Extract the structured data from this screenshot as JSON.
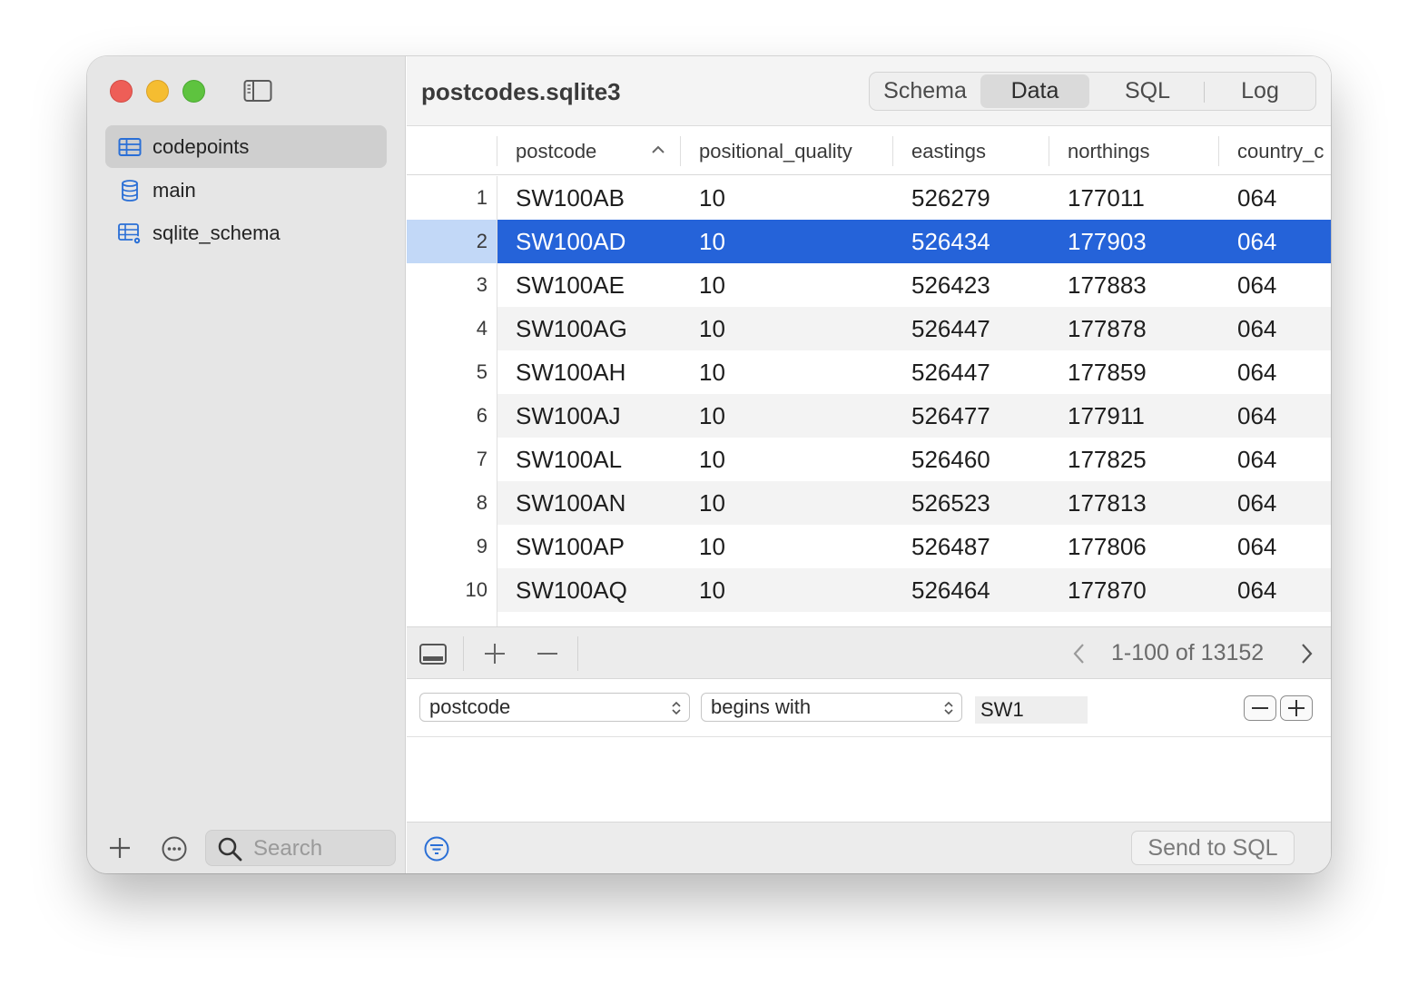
{
  "colors": {
    "accent": "#2563d9",
    "selected_rownum": "#c2d8f7",
    "close": "#ee5e57",
    "minimize": "#f5bd31",
    "zoom": "#5ec33f"
  },
  "window": {
    "title": "postcodes.sqlite3"
  },
  "tabs": [
    {
      "label": "Schema",
      "active": false
    },
    {
      "label": "Data",
      "active": true
    },
    {
      "label": "SQL",
      "active": false
    },
    {
      "label": "Log",
      "active": false
    }
  ],
  "sidebar": {
    "items": [
      {
        "label": "codepoints",
        "icon": "table-icon",
        "selected": true
      },
      {
        "label": "main",
        "icon": "database-icon",
        "selected": false
      },
      {
        "label": "sqlite_schema",
        "icon": "table-settings-icon",
        "selected": false
      }
    ],
    "search_placeholder": "Search"
  },
  "table": {
    "columns": [
      "postcode",
      "positional_quality",
      "eastings",
      "northings",
      "country_c"
    ],
    "sort": {
      "column": "postcode",
      "direction": "ascending"
    },
    "selected_row": 2,
    "rows": [
      {
        "n": "1",
        "cells": [
          "SW100AB",
          "10",
          "526279",
          "177011",
          "064"
        ]
      },
      {
        "n": "2",
        "cells": [
          "SW100AD",
          "10",
          "526434",
          "177903",
          "064"
        ]
      },
      {
        "n": "3",
        "cells": [
          "SW100AE",
          "10",
          "526423",
          "177883",
          "064"
        ]
      },
      {
        "n": "4",
        "cells": [
          "SW100AG",
          "10",
          "526447",
          "177878",
          "064"
        ]
      },
      {
        "n": "5",
        "cells": [
          "SW100AH",
          "10",
          "526447",
          "177859",
          "064"
        ]
      },
      {
        "n": "6",
        "cells": [
          "SW100AJ",
          "10",
          "526477",
          "177911",
          "064"
        ]
      },
      {
        "n": "7",
        "cells": [
          "SW100AL",
          "10",
          "526460",
          "177825",
          "064"
        ]
      },
      {
        "n": "8",
        "cells": [
          "SW100AN",
          "10",
          "526523",
          "177813",
          "064"
        ]
      },
      {
        "n": "9",
        "cells": [
          "SW100AP",
          "10",
          "526487",
          "177806",
          "064"
        ]
      },
      {
        "n": "10",
        "cells": [
          "SW100AQ",
          "10",
          "526464",
          "177870",
          "064"
        ]
      }
    ]
  },
  "pager": {
    "text": "1-100 of 13152"
  },
  "filter": {
    "column": "postcode",
    "operator": "begins with",
    "value": "SW1"
  },
  "bottom": {
    "send_label": "Send to SQL"
  }
}
